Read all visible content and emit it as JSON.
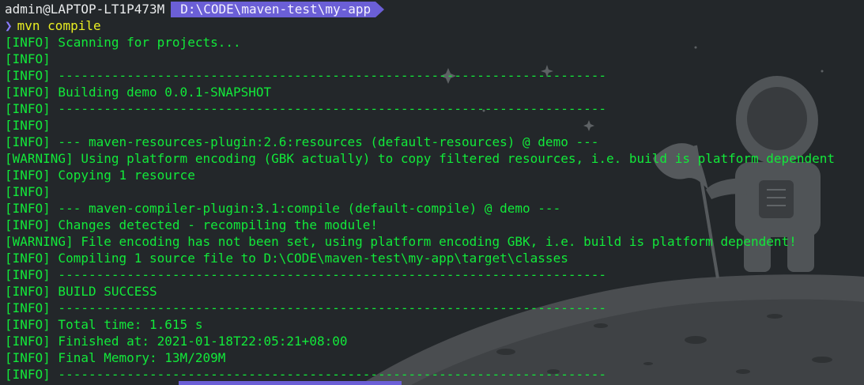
{
  "prompt": {
    "user_host": "admin@LAPTOP-LT1P473M",
    "path": "D:\\CODE\\maven-test\\my-app",
    "chevron": "❯",
    "command": "mvn compile"
  },
  "output_lines": [
    "[INFO] Scanning for projects...",
    "[INFO]",
    "[INFO] ------------------------------------------------------------------------",
    "[INFO] Building demo 0.0.1-SNAPSHOT",
    "[INFO] ------------------------------------------------------------------------",
    "[INFO]",
    "[INFO] --- maven-resources-plugin:2.6:resources (default-resources) @ demo ---",
    "[WARNING] Using platform encoding (GBK actually) to copy filtered resources, i.e. build is platform dependent",
    "[INFO] Copying 1 resource",
    "[INFO]",
    "[INFO] --- maven-compiler-plugin:3.1:compile (default-compile) @ demo ---",
    "[INFO] Changes detected - recompiling the module!",
    "[WARNING] File encoding has not been set, using platform encoding GBK, i.e. build is platform dependent!",
    "[INFO] Compiling 1 source file to D:\\CODE\\maven-test\\my-app\\target\\classes",
    "[INFO] ------------------------------------------------------------------------",
    "[INFO] BUILD SUCCESS",
    "[INFO] ------------------------------------------------------------------------",
    "[INFO] Total time: 1.615 s",
    "[INFO] Finished at: 2021-01-18T22:05:21+08:00",
    "[INFO] Final Memory: 13M/209M",
    "[INFO] ------------------------------------------------------------------------"
  ],
  "colors": {
    "background": "#23272a",
    "output_text": "#12e93a",
    "command_text": "#e9ee22",
    "path_segment": "#6b5fd6",
    "user_host_text": "#e9ebec"
  },
  "background_art": "astronaut-planting-flag-on-moon"
}
